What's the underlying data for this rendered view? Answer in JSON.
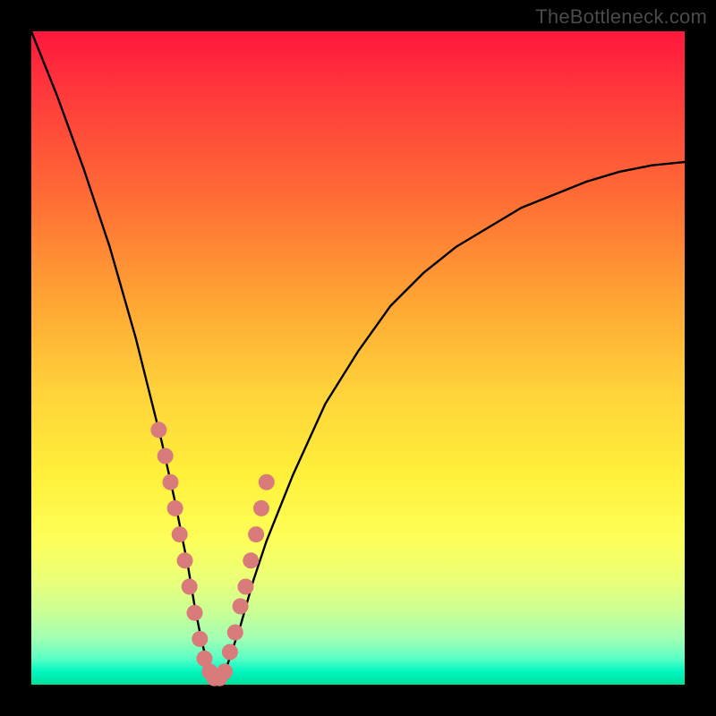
{
  "watermark": "TheBottleneck.com",
  "colors": {
    "curve_stroke": "#000000",
    "marker_fill": "#d87b7a",
    "marker_stroke": "#b55a59"
  },
  "chart_data": {
    "type": "line",
    "title": "",
    "xlabel": "",
    "ylabel": "",
    "xlim": [
      0,
      100
    ],
    "ylim": [
      0,
      100
    ],
    "grid": false,
    "legend": false,
    "series": [
      {
        "name": "bottleneck-curve",
        "x": [
          0,
          4,
          8,
          12,
          16,
          18,
          20,
          22,
          23,
          24,
          25,
          26,
          27,
          28,
          29,
          30,
          32,
          34,
          36,
          40,
          45,
          50,
          55,
          60,
          65,
          70,
          75,
          80,
          85,
          90,
          95,
          100
        ],
        "y": [
          100,
          90,
          79,
          67,
          53,
          45,
          37,
          28,
          23,
          18,
          12,
          7,
          3,
          1,
          1,
          3,
          9,
          16,
          22,
          32,
          43,
          51,
          58,
          63,
          67,
          70,
          73,
          75,
          77,
          78.5,
          79.5,
          80
        ]
      }
    ],
    "markers": {
      "name": "highlighted-points",
      "x": [
        19.5,
        20.5,
        21.3,
        22.0,
        22.7,
        23.5,
        24.2,
        25.0,
        25.8,
        26.5,
        27.3,
        28.0,
        28.8,
        29.6,
        30.4,
        31.2,
        32.0,
        32.8,
        33.6,
        34.4,
        35.2,
        36.0
      ],
      "y": [
        39,
        35,
        31,
        27,
        23,
        19,
        15,
        11,
        7,
        4,
        2,
        1,
        1,
        2,
        5,
        8,
        12,
        15,
        19,
        23,
        27,
        31
      ]
    }
  }
}
